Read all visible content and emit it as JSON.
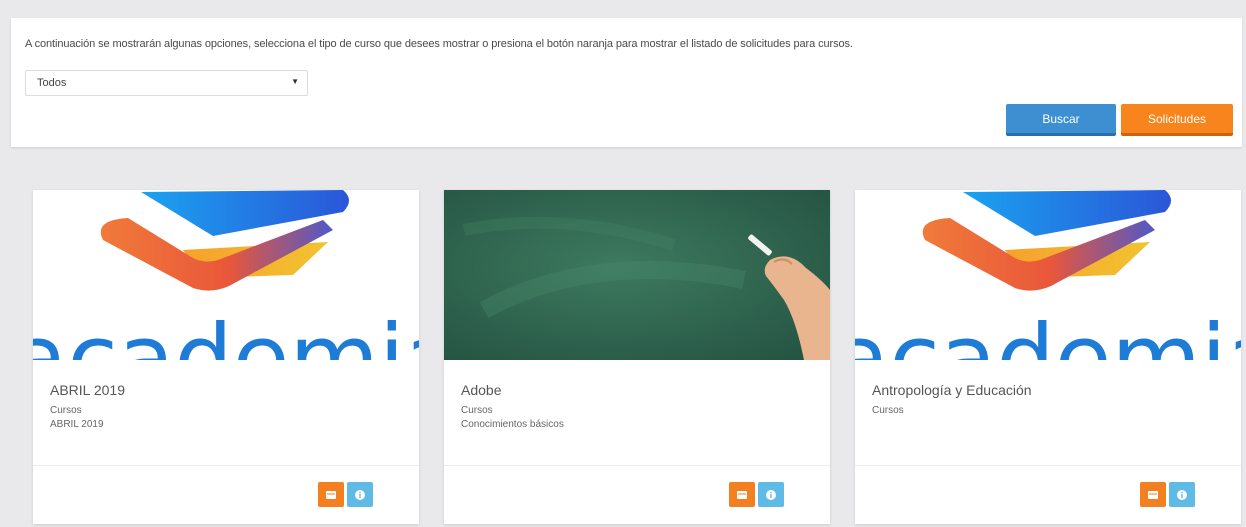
{
  "filter": {
    "intro_text": "A continuación se mostrarán algunas opciones, selecciona el tipo de curso que desees mostrar o presiona el botón naranja para mostrar el listado de solicitudes para cursos.",
    "select": {
      "selected": "Todos",
      "caret": "▼"
    },
    "search_label": "Buscar",
    "requests_label": "Solicitudes"
  },
  "cards": [
    {
      "image": "academia-logo",
      "logo_text": "academia",
      "title": "ABRIL 2019",
      "line1": "Cursos",
      "line2": "ABRIL 2019",
      "actions": [
        "calendar-icon",
        "info-icon"
      ]
    },
    {
      "image": "chalkboard-photo",
      "title": "Adobe",
      "line1": "Cursos",
      "line2": "Conocimientos básicos",
      "actions": [
        "calendar-icon",
        "info-icon"
      ]
    },
    {
      "image": "academia-logo",
      "logo_text": "academia",
      "title": "Antropología y Educación",
      "line1": "Cursos",
      "line2": "",
      "actions": [
        "calendar-icon",
        "info-icon"
      ]
    }
  ],
  "colors": {
    "primary_blue": "#3d8fd1",
    "accent_orange": "#f7841d",
    "info_blue": "#5fbbe6",
    "logo_blue": "#1e7bd6",
    "chalkboard_green": "#2f6b52"
  }
}
